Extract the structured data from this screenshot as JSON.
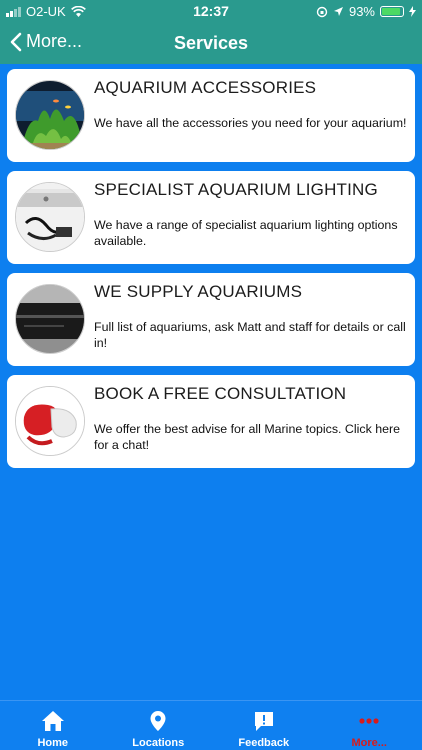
{
  "status": {
    "carrier": "O2-UK",
    "time": "12:37",
    "battery": "93%",
    "battery_level": 0.93
  },
  "nav": {
    "back_label": "More...",
    "title": "Services"
  },
  "services": [
    {
      "title": "AQUARIUM ACCESSORIES",
      "description": "We have all the accessories you need for your aquarium!",
      "icon": "aquarium-plants-image"
    },
    {
      "title": "SPECIALIST AQUARIUM LIGHTING",
      "description": "We have a range of specialist aquarium lighting options available.",
      "icon": "aquarium-light-image"
    },
    {
      "title": "WE SUPPLY AQUARIUMS",
      "description": "Full list of aquariums, ask Matt and staff for details or call in!",
      "icon": "aquarium-tank-image"
    },
    {
      "title": "BOOK A FREE CONSULTATION",
      "description": "We offer the best advise for all Marine topics. Click here for a chat!",
      "icon": "consultation-image"
    }
  ],
  "tabs": [
    {
      "label": "Home",
      "icon": "home-icon"
    },
    {
      "label": "Locations",
      "icon": "location-pin-icon"
    },
    {
      "label": "Feedback",
      "icon": "feedback-icon"
    },
    {
      "label": "More...",
      "icon": "more-dots-icon",
      "active": true
    }
  ],
  "colors": {
    "header": "#2a9a8e",
    "background": "#0d7fef",
    "active_tab": "#d81b1b"
  }
}
